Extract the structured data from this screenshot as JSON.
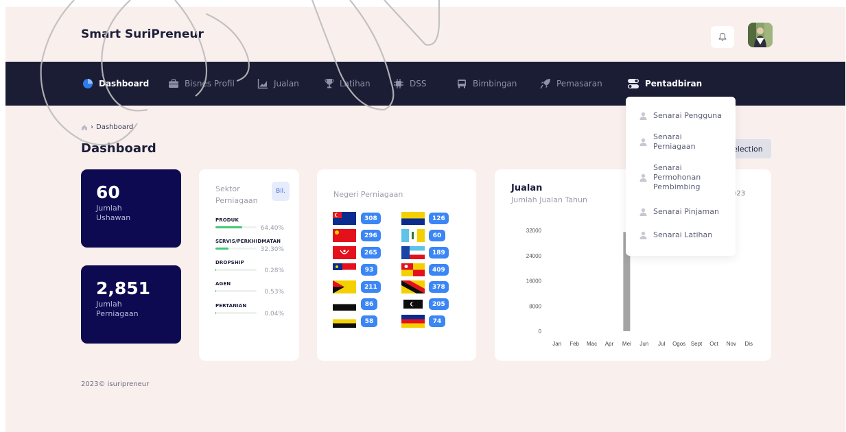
{
  "header": {
    "brand": "Smart SuriPreneur"
  },
  "nav": {
    "items": [
      {
        "label": "Dashboard",
        "icon": "pie-chart-icon"
      },
      {
        "label": "Bisnes Profil",
        "icon": "briefcase-icon"
      },
      {
        "label": "Jualan",
        "icon": "line-chart-icon"
      },
      {
        "label": "Latihan",
        "icon": "trophy-icon"
      },
      {
        "label": "DSS",
        "icon": "chip-icon"
      },
      {
        "label": "Bimbingan",
        "icon": "bus-icon"
      },
      {
        "label": "Pemasaran",
        "icon": "rocket-icon"
      },
      {
        "label": "Pentadbiran",
        "icon": "toggle-icon"
      }
    ]
  },
  "dropdown": {
    "items": [
      "Senarai Pengguna",
      "Senarai Perniagaan",
      "Senarai Permohonan Pembimbing",
      "Senarai Pinjaman",
      "Senarai Latihan"
    ]
  },
  "breadcrumb": {
    "current": "Dashboard"
  },
  "page": {
    "title": "Dashboard",
    "selection_btn": "election"
  },
  "stats": [
    {
      "value": "60",
      "label": "Jumlah Ushawan"
    },
    {
      "value": "2,851",
      "label": "Jumlah Perniagaan"
    }
  ],
  "sektor": {
    "title": "Sektor Perniagaan",
    "bil_btn": "Bil.",
    "rows": [
      {
        "name": "PRODUK",
        "pct_label": "64.40%",
        "pct": 64.4
      },
      {
        "name": "SERVIS/PERKHIDMATAN",
        "pct_label": "32.30%",
        "pct": 32.3
      },
      {
        "name": "DROPSHIP",
        "pct_label": "0.28%",
        "pct": 0.28
      },
      {
        "name": "AGEN",
        "pct_label": "0.53%",
        "pct": 0.53
      },
      {
        "name": "PERTANIAN",
        "pct_label": "0.04%",
        "pct": 0.04
      }
    ]
  },
  "negeri": {
    "title": "Negeri Perniagaan",
    "left": [
      {
        "count": "308",
        "flag": "johor"
      },
      {
        "count": "296",
        "flag": "kedah"
      },
      {
        "count": "265",
        "flag": "kelantan"
      },
      {
        "count": "93",
        "flag": "melaka"
      },
      {
        "count": "211",
        "flag": "negeri-sembilan"
      },
      {
        "count": "86",
        "flag": "pahang"
      },
      {
        "count": "58",
        "flag": "perak"
      }
    ],
    "right": [
      {
        "count": "126",
        "flag": "perlis"
      },
      {
        "count": "60",
        "flag": "pulau-pinang"
      },
      {
        "count": "189",
        "flag": "sabah"
      },
      {
        "count": "409",
        "flag": "selangor"
      },
      {
        "count": "378",
        "flag": "sarawak"
      },
      {
        "count": "205",
        "flag": "terengganu"
      },
      {
        "count": "74",
        "flag": "kuala-lumpur"
      }
    ]
  },
  "jualan": {
    "title": "Jualan",
    "subtitle": "Jumlah Jualan Tahun",
    "year_partial": "023"
  },
  "chart_data": {
    "type": "bar",
    "categories": [
      "Jan",
      "Feb",
      "Mac",
      "Apr",
      "Mei",
      "Jun",
      "Jul",
      "Ogos",
      "Sept",
      "Oct",
      "Nov",
      "Dis"
    ],
    "values": [
      0,
      0,
      0,
      0,
      31500,
      0,
      0,
      0,
      0,
      0,
      0,
      0
    ],
    "yticks": [
      "0",
      "8000",
      "16000",
      "24000",
      "32000"
    ],
    "ylim": [
      0,
      32000
    ],
    "bar_color": "#a4a4a4",
    "grid": false
  },
  "footer": {
    "text": "2023© isuripreneur"
  },
  "colors": {
    "navbar": "#1a1d34",
    "stat_card": "#0d0a52",
    "badge": "#3b86f5",
    "progress": "#40c872"
  }
}
